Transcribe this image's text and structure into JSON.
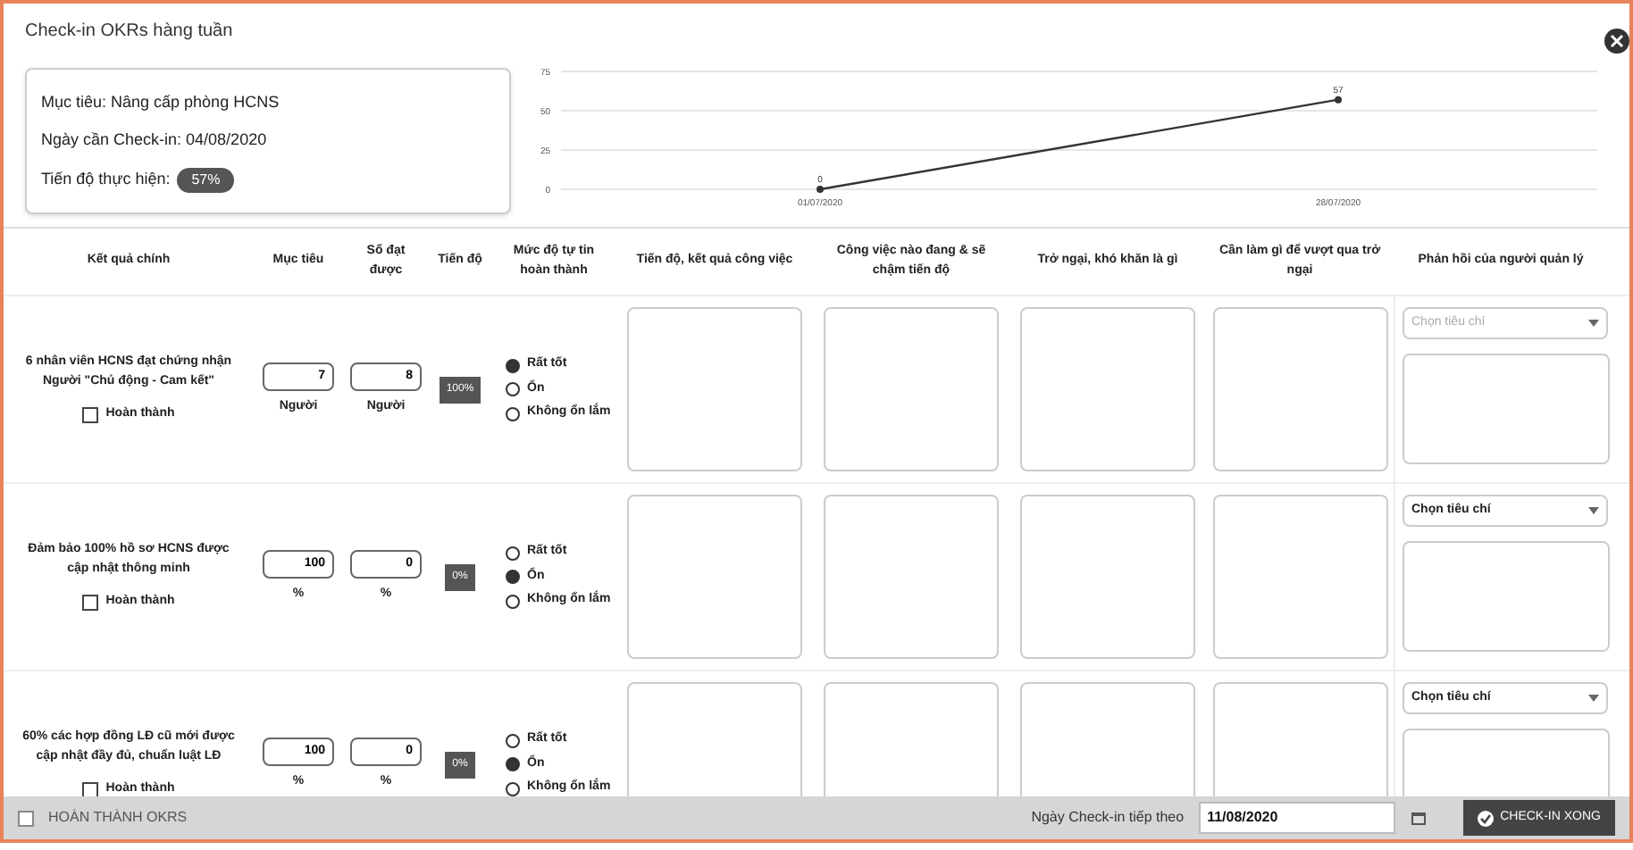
{
  "window": {
    "title": "Check-in OKRs hàng tuần"
  },
  "objective": {
    "title": "Mục tiêu: Nâng cấp phòng HCNS",
    "checkin_date": "Ngày cần Check-in: 04/08/2020",
    "progress_label": "Tiến độ thực hiện:",
    "progress": "57%"
  },
  "chart_data": {
    "type": "line",
    "categories": [
      "01/07/2020",
      "28/07/2020"
    ],
    "series": [
      {
        "color": "#333333",
        "marker": true,
        "values": [
          0,
          57
        ]
      }
    ],
    "ylim": [
      0,
      75
    ],
    "yticks": [
      0,
      25,
      50,
      75
    ],
    "data_labels": true
  },
  "table": {
    "columns": [
      "Kết quả chính",
      "Mục tiêu",
      "Số đạt được",
      "Tiến độ",
      "Mức độ tự tin hoàn thành",
      "Tiến độ, kết quả công việc",
      "Công việc nào đang & sẽ chậm tiến độ",
      "Trở ngại, khó khăn là gì",
      "Cần làm gì để vượt qua trở ngại",
      "Phản hồi của người quản lý"
    ],
    "rows": [
      {
        "key_result": "6 nhân viên HCNS đạt chứng nhận Người \"Chủ động - Cam kết\"",
        "done_label": "Hoàn thành",
        "done": false,
        "target": "7",
        "target_unit": "Người",
        "achieved": "8",
        "achieved_unit": "Người",
        "progress": "100%",
        "confidence": [
          {
            "label": "Rất tốt",
            "selected": true
          },
          {
            "label": "Ổn",
            "selected": false
          },
          {
            "label": "Không ổn lắm",
            "selected": false
          }
        ],
        "criteria": {
          "placeholder": "Chọn tiêu chí",
          "disabled": true
        }
      },
      {
        "key_result": "Đảm bảo 100% hồ sơ HCNS được cập nhật thông minh",
        "done_label": "Hoàn thành",
        "done": false,
        "target": "100",
        "target_unit": "%",
        "achieved": "0",
        "achieved_unit": "%",
        "progress": "0%",
        "confidence": [
          {
            "label": "Rất tốt",
            "selected": false
          },
          {
            "label": "Ổn",
            "selected": true
          },
          {
            "label": "Không ổn lắm",
            "selected": false
          }
        ],
        "criteria": {
          "placeholder": "Chọn tiêu chí",
          "disabled": false
        }
      },
      {
        "key_result": "60% các hợp đồng LĐ cũ mới được cập nhật đầy đủ, chuẩn luật LĐ",
        "done_label": "Hoàn thành",
        "done": false,
        "target": "100",
        "target_unit": "%",
        "achieved": "0",
        "achieved_unit": "%",
        "progress": "0%",
        "confidence": [
          {
            "label": "Rất tốt",
            "selected": false
          },
          {
            "label": "Ổn",
            "selected": true
          },
          {
            "label": "Không ổn lắm",
            "selected": false
          }
        ],
        "criteria": {
          "placeholder": "Chọn tiêu chí",
          "disabled": false
        }
      }
    ]
  },
  "footer": {
    "complete": {
      "label": "HOÀN THÀNH OKRS",
      "checked": false
    },
    "next_date_label": "Ngày Check-in tiếp theo",
    "next_date": "11/08/2020",
    "submit": "CHECK-IN XONG"
  }
}
